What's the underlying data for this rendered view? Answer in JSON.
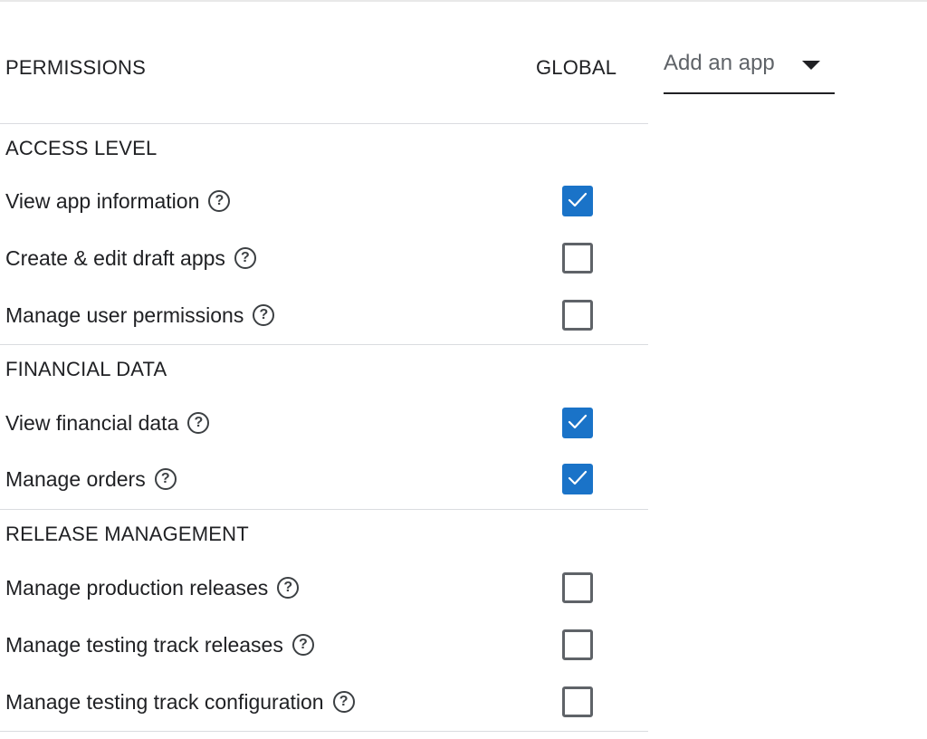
{
  "header": {
    "permissions_label": "PERMISSIONS",
    "global_label": "GLOBAL",
    "add_app": {
      "label": "Add an app",
      "icon": "caret-down-icon"
    }
  },
  "sections": [
    {
      "title": "ACCESS LEVEL",
      "items": [
        {
          "label": "View app information",
          "checked": true
        },
        {
          "label": "Create & edit draft apps",
          "checked": false
        },
        {
          "label": "Manage user permissions",
          "checked": false
        }
      ]
    },
    {
      "title": "FINANCIAL DATA",
      "items": [
        {
          "label": "View financial data",
          "checked": true
        },
        {
          "label": "Manage orders",
          "checked": true
        }
      ]
    },
    {
      "title": "RELEASE MANAGEMENT",
      "items": [
        {
          "label": "Manage production releases",
          "checked": false
        },
        {
          "label": "Manage testing track releases",
          "checked": false
        },
        {
          "label": "Manage testing track configuration",
          "checked": false
        }
      ]
    }
  ],
  "icons": {
    "help": "help-circle-icon",
    "check": "checkmark-icon"
  },
  "colors": {
    "checked_fill": "#1a73c8",
    "divider": "#dadce0",
    "text": "#202124"
  }
}
